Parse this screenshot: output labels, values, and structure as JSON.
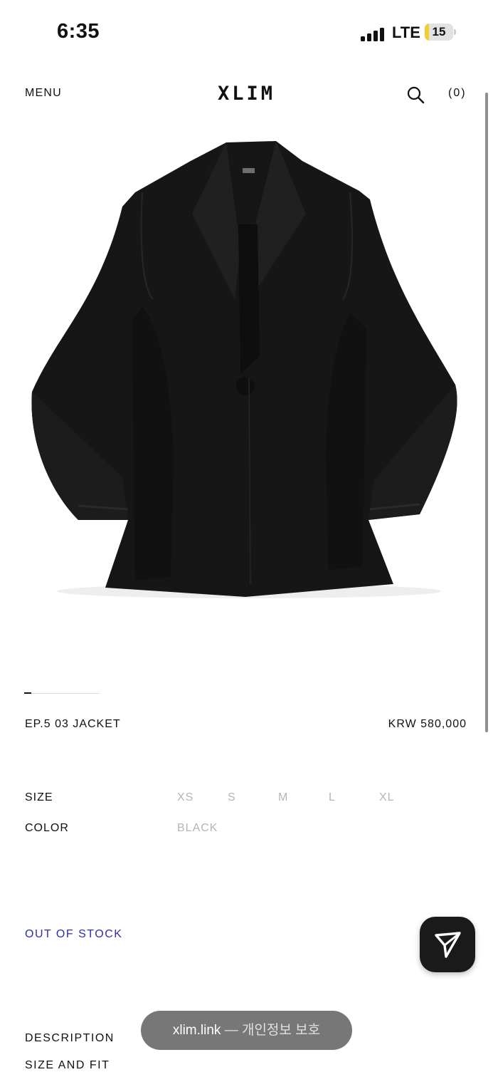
{
  "status_bar": {
    "time": "6:35",
    "network": "LTE",
    "battery": "15",
    "battery_level": 0.15
  },
  "nav": {
    "menu_label": "MENU",
    "logo": "XLIM",
    "cart_label": "(0)"
  },
  "carousel": {
    "current_index": 1
  },
  "product": {
    "name": "EP.5 03 JACKET",
    "price": "KRW 580,000",
    "size_label": "SIZE",
    "sizes": [
      "XS",
      "S",
      "M",
      "L",
      "XL"
    ],
    "color_label": "COLOR",
    "colors": [
      "BLACK"
    ],
    "stock_status": "OUT OF STOCK"
  },
  "sections": {
    "description": "DESCRIPTION",
    "size_and_fit": "SIZE AND FIT"
  },
  "toast": {
    "domain": "xlim.link",
    "separator": "—",
    "message": "개인정보 보호"
  },
  "colors": {
    "stock_status": "#2f2fa6",
    "option_disabled": "#b5b5b5",
    "battery_fill": "#f5cc2e"
  },
  "icons": {
    "search": "search-icon",
    "send": "send-icon",
    "signal": "signal-icon",
    "battery": "battery-icon"
  }
}
